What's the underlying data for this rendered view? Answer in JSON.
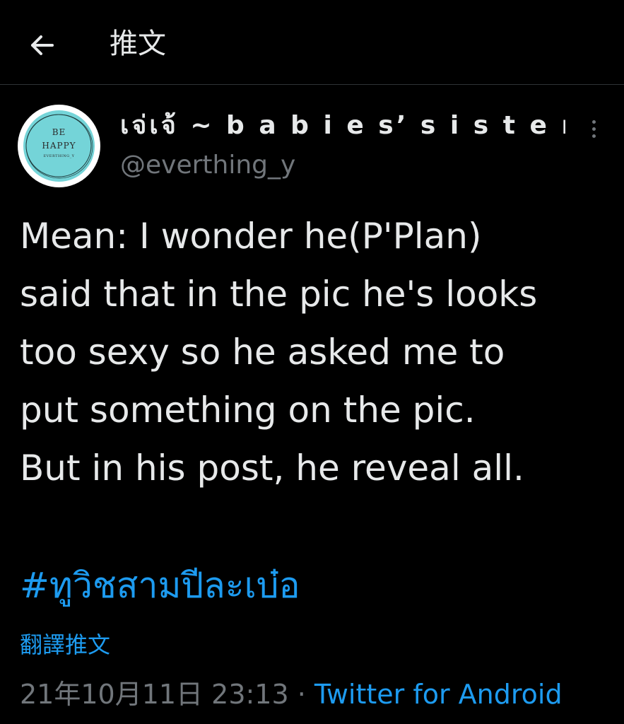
{
  "header": {
    "back_icon": "arrow-left-icon",
    "title": "推文"
  },
  "author": {
    "avatar": {
      "line1": "BE",
      "line2": "HAPPY",
      "line3": "EVERTHING_Y",
      "ring_color": "#ffffff",
      "fill_color": "#74d4d8"
    },
    "display_name": "เจ่เจ้ ~ b a b i e s’ s i s t e r ~ ...",
    "handle": "@everthing_y",
    "more_icon": "more-vertical-icon"
  },
  "tweet": {
    "text": "Mean: I wonder he(P'Plan)\nsaid that in the pic he's looks\ntoo sexy so he asked me to\nput something on the pic.\nBut in his post, he reveal all.",
    "hashtag": "#ทูวิชสามปีละเบ๋อ",
    "translate_label": "翻譯推文",
    "timestamp": "21年10月11日 23:13",
    "separator": " · ",
    "source": "Twitter for Android"
  },
  "colors": {
    "background": "#000000",
    "text": "#e7e9ea",
    "muted": "#71767b",
    "link": "#1d9bf0",
    "divider": "#2f3336"
  }
}
